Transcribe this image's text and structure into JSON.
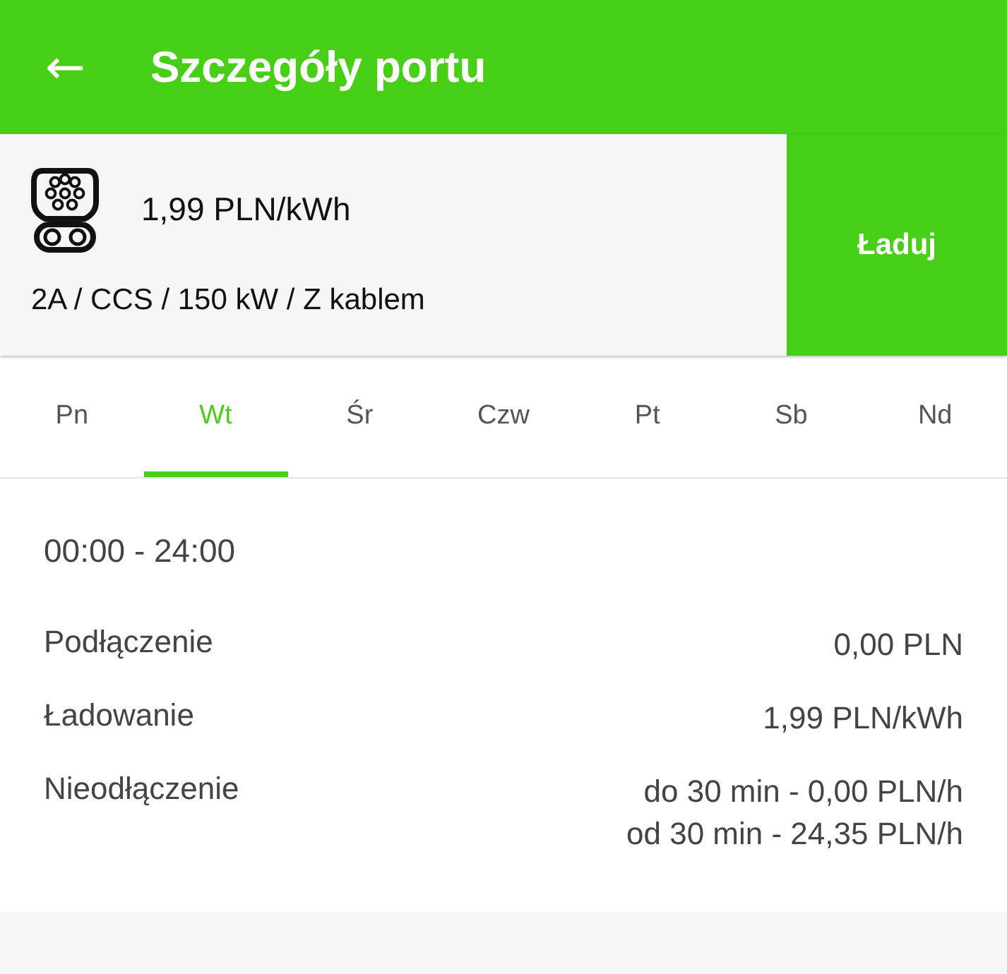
{
  "app_bar": {
    "back": "←",
    "title": "Szczegóły portu"
  },
  "port": {
    "price": "1,99 PLN/kWh",
    "specs": "2A / CCS / 150 kW / Z kablem",
    "action": "Ładuj"
  },
  "tabs": [
    {
      "label": "Pn",
      "selected": false
    },
    {
      "label": "Wt",
      "selected": true
    },
    {
      "label": "Śr",
      "selected": false
    },
    {
      "label": "Czw",
      "selected": false
    },
    {
      "label": "Pt",
      "selected": false
    },
    {
      "label": "Sb",
      "selected": false
    },
    {
      "label": "Nd",
      "selected": false
    }
  ],
  "schedule": {
    "hours": "00:00 - 24:00",
    "fees": [
      {
        "label": "Podłączenie",
        "values": [
          "0,00 PLN"
        ]
      },
      {
        "label": "Ładowanie",
        "values": [
          "1,99 PLN/kWh"
        ]
      },
      {
        "label": "Nieodłączenie",
        "values": [
          "do 30 min - 0,00 PLN/h",
          "od 30 min - 24,35 PLN/h"
        ]
      }
    ]
  }
}
